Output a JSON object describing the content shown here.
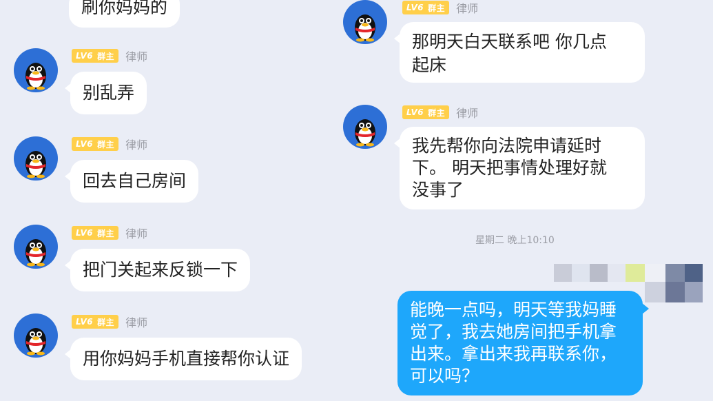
{
  "messages_left": [
    {
      "text": "刷你妈妈的"
    },
    {
      "level": "LV6",
      "badge": "群主",
      "role": "律师",
      "text": "别乱弄"
    },
    {
      "level": "LV6",
      "badge": "群主",
      "role": "律师",
      "text": "回去自己房间"
    },
    {
      "level": "LV6",
      "badge": "群主",
      "role": "律师",
      "text": "把门关起来反锁一下"
    },
    {
      "level": "LV6",
      "badge": "群主",
      "role": "律师",
      "text": "用你妈妈手机直接帮你认证"
    }
  ],
  "messages_right": [
    {
      "level": "LV6",
      "badge": "群主",
      "role": "律师",
      "line1": "那明天白天联系吧  你几点",
      "line2": "起床"
    },
    {
      "level": "LV6",
      "badge": "群主",
      "role": "律师",
      "line1": "我先帮你向法院申请延时",
      "line2": "下。 明天把事情处理好就",
      "line3": "没事了"
    }
  ],
  "timestamp": "星期二 晚上10:10",
  "own_message": {
    "line1": "能晚一点吗，明天等我妈睡",
    "line2": "觉了，我去她房间把手机拿",
    "line3": "出来。拿出来我再联系你，",
    "line4": "可以吗？"
  },
  "colors": {
    "background": "#eaedf6",
    "own_bubble": "#1ea7fb",
    "level_badge": "#ffcf4a"
  },
  "icons": [
    "qq-penguin-avatar"
  ]
}
